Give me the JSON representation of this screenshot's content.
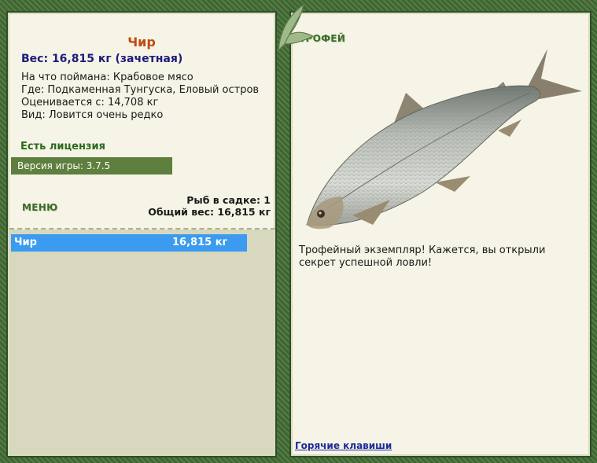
{
  "fish": {
    "name": "Чир",
    "weight_line": "Вес: 16,815 кг (зачетная)",
    "caught_on": "На что поймана: Крабовое мясо",
    "location": "Где: Подкаменная Тунгуска, Еловый остров",
    "valued_from": "Оценивается с: 14,708 кг",
    "rarity": "Вид: Ловится очень редко"
  },
  "license_text": "Есть лицензия",
  "version_text": "Версия игры: 3.7.5",
  "menu_label": "МЕНЮ",
  "stats": {
    "fish_count": "Рыб в садке: 1",
    "total_weight": "Общий вес: 16,815 кг"
  },
  "keep_net": [
    {
      "name": "Чир",
      "weight": "16,815 кг"
    }
  ],
  "trophy": {
    "label": "ТРОФЕЙ",
    "text": "Трофейный экземпляр! Кажется, вы открыли секрет успешной ловли!"
  },
  "hotkeys_link": "Горячие клавиши",
  "colors": {
    "frame_green": "#3f6a34",
    "panel_bg": "#f6f4e6",
    "fish_name": "#c04a10",
    "weight": "#1d1b7a",
    "license": "#2b6a1f",
    "version_bar": "#5e7f3e",
    "selected_row": "#3a9bf0",
    "link": "#1b2d9a"
  }
}
